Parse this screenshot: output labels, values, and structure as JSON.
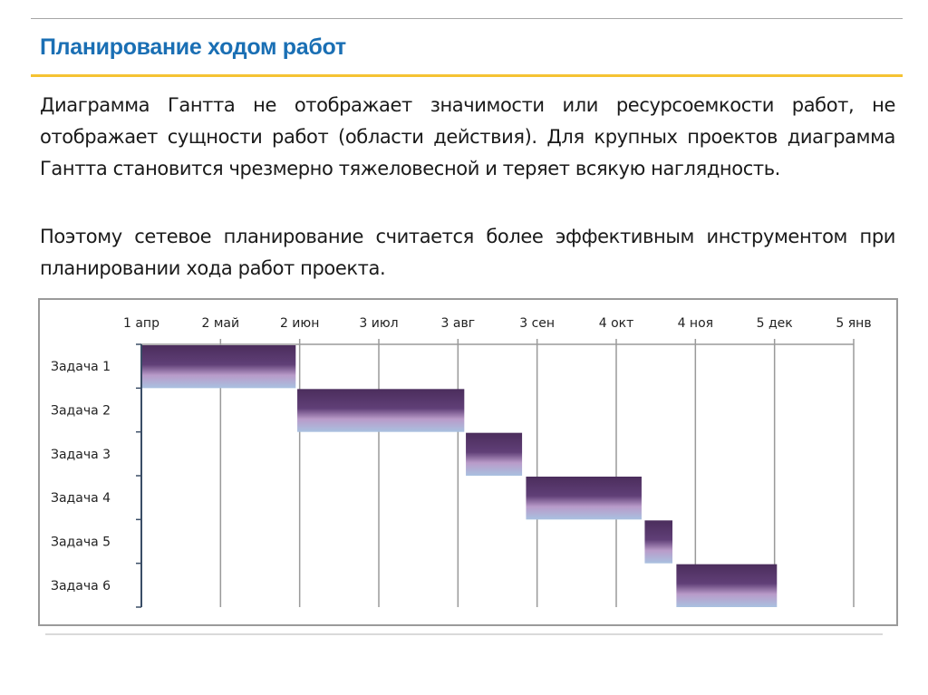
{
  "slide": {
    "title": "Планирование ходом работ",
    "paragraphs": [
      "Диаграмма Гантта не отображает значимости или ресурсоемкости работ, не отображает сущности работ (области действия). Для крупных проектов диаграмма Гантта становится чрезмерно тяжеловесной и теряет всякую наглядность.",
      "Поэтому сетевое планирование считается более эффективным инструментом при планировании хода работ проекта."
    ],
    "colors": {
      "title": "#1a6fb4",
      "title_rule": "#f5c332",
      "bar_top": "#4b2d5c",
      "bar_mid": "#b99bc9",
      "bar_bottom": "#a9c1e0",
      "grid": "#9a9a9a",
      "axis": "#3a4d66"
    }
  },
  "chart_data": {
    "type": "gantt",
    "title": "",
    "xlabel": "",
    "ylabel": "",
    "x_ticks": [
      "1 апр",
      "2 май",
      "2 июн",
      "3 июл",
      "3 авг",
      "3 сен",
      "4 окт",
      "4 ноя",
      "5 дек",
      "5 янв"
    ],
    "x_unit": "months from 1 апр",
    "xlim": [
      0,
      9
    ],
    "grid": true,
    "legend": "none",
    "tasks": [
      {
        "name": "Задача 1",
        "start": 0.0,
        "end": 1.95
      },
      {
        "name": "Задача 2",
        "start": 1.97,
        "end": 4.08
      },
      {
        "name": "Задача 3",
        "start": 4.1,
        "end": 4.81
      },
      {
        "name": "Задача 4",
        "start": 4.86,
        "end": 6.32
      },
      {
        "name": "Задача 5",
        "start": 6.36,
        "end": 6.71
      },
      {
        "name": "Задача 6",
        "start": 6.76,
        "end": 8.03
      }
    ]
  }
}
